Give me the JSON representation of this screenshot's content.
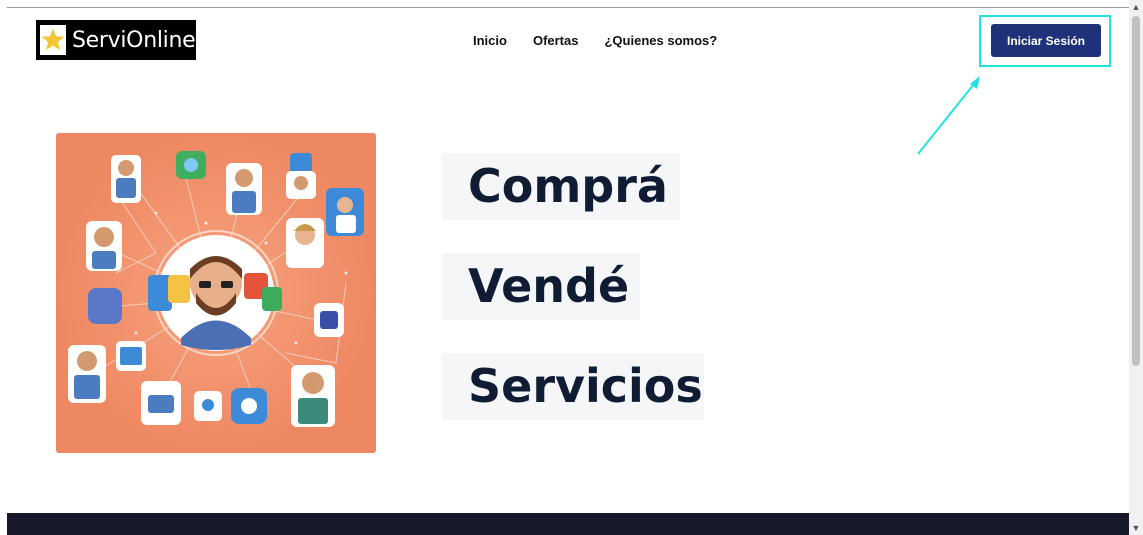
{
  "header": {
    "logo_text": "ServiOnline!",
    "logo_icon": "star-icon",
    "nav": [
      "Inicio",
      "Ofertas",
      "¿Quienes somos?"
    ],
    "login_label": "Iniciar Sesión"
  },
  "hero": {
    "words": [
      "Comprá",
      "Vendé",
      "Servicios"
    ],
    "image": "network-of-service-people-illustration"
  },
  "colors": {
    "accent": "#1e3179",
    "highlight": "#22e3e3",
    "hero_bg": "#ee8862",
    "footer": "#161a2b"
  }
}
